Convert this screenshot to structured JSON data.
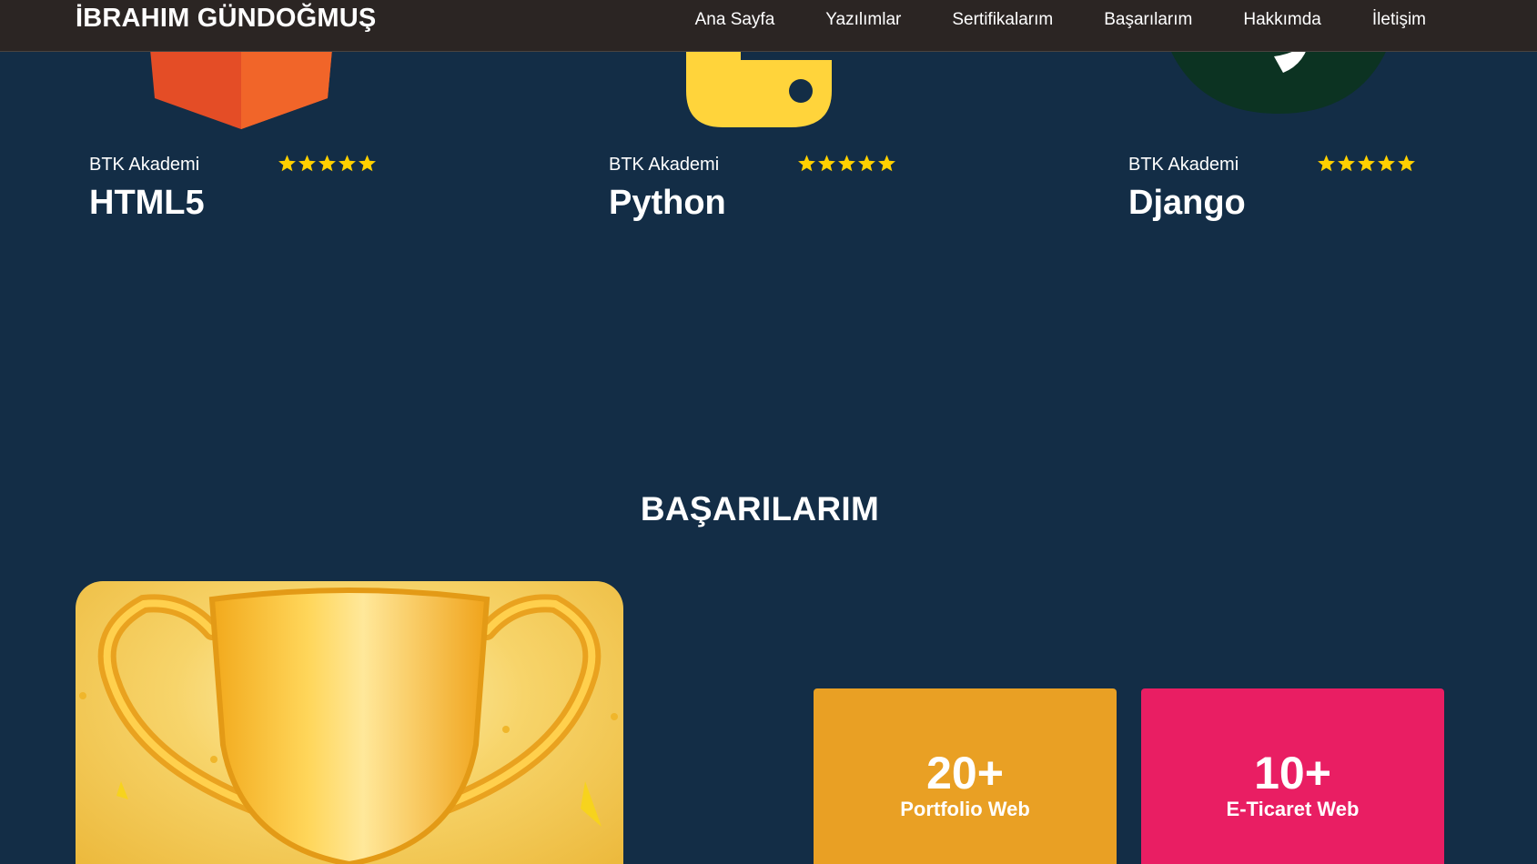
{
  "navbar": {
    "brand": "İBRAHIM GÜNDOĞMUŞ",
    "links": [
      "Ana Sayfa",
      "Yazılımlar",
      "Sertifikalarım",
      "Başarılarım",
      "Hakkımda",
      "İletişim"
    ]
  },
  "certificates": [
    {
      "org": "BTK Akademi",
      "title": "HTML5",
      "rating": 5,
      "icon": "html5-logo-icon"
    },
    {
      "org": "BTK Akademi",
      "title": "Python",
      "rating": 5,
      "icon": "python-logo-icon"
    },
    {
      "org": "BTK Akademi",
      "title": "Django",
      "rating": 5,
      "icon": "django-logo-icon"
    }
  ],
  "achievements": {
    "title": "BAŞARILARIM",
    "image_icon": "trophy-icon",
    "stats": [
      {
        "value": "20+",
        "label": "Portfolio Web",
        "color": "#e9a024"
      },
      {
        "value": "10+",
        "label": "E-Ticaret Web",
        "color": "#e91e63"
      }
    ]
  },
  "colors": {
    "background": "#132d46",
    "navbar": "#2b2523",
    "star": "#ffd000"
  }
}
